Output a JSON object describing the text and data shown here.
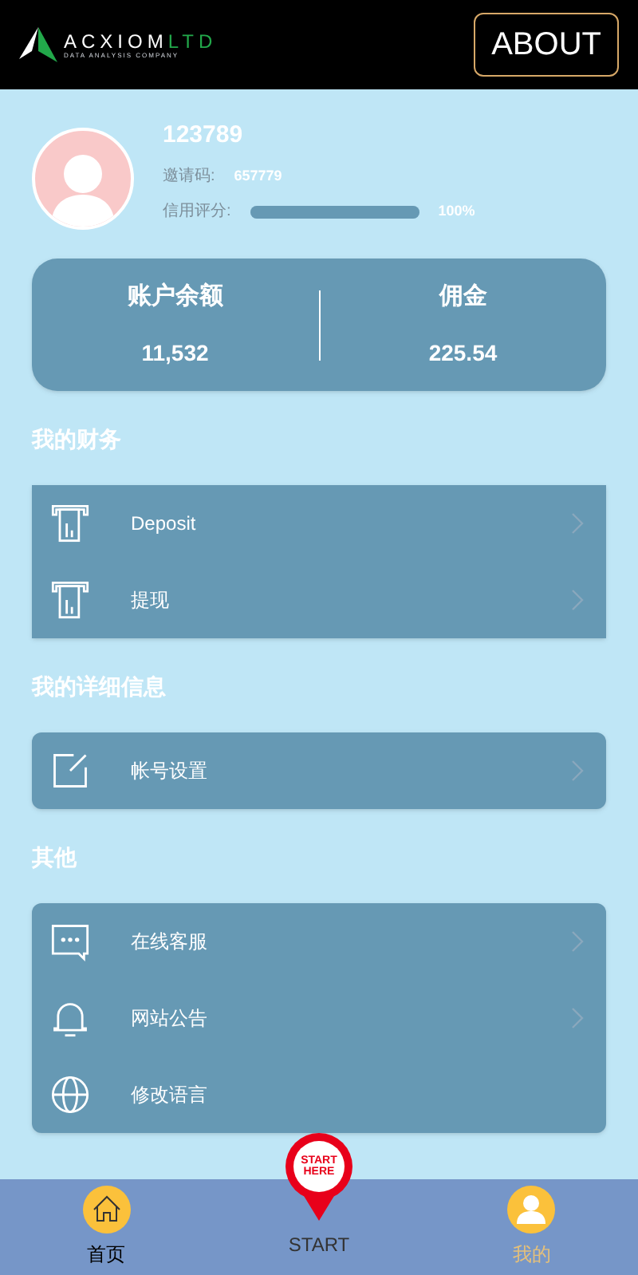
{
  "header": {
    "logo": {
      "name": "ACXIOM",
      "suffix": "LTD",
      "tagline": "DATA ANALYSIS COMPANY"
    },
    "about_button": "ABOUT"
  },
  "profile": {
    "username": "123789",
    "invite_label": "邀请码:",
    "invite_code": "657779",
    "credit_label": "信用评分:",
    "credit": {
      "level": 1.0
    },
    "credit_reading": "100%"
  },
  "balances": [
    {
      "label": "账户余额",
      "value": "11,532"
    },
    {
      "label": "佣金",
      "value": "225.54"
    }
  ],
  "sections": [
    {
      "title": "我的财务",
      "rounded": false,
      "items": [
        {
          "kind": "atm",
          "label": "Deposit",
          "chevron": true
        },
        {
          "kind": "atm",
          "label": "提现",
          "chevron": true
        }
      ]
    },
    {
      "title": "我的详细信息",
      "rounded": true,
      "items": [
        {
          "kind": "edit",
          "label": "帐号设置",
          "chevron": true
        }
      ]
    },
    {
      "title": "其他",
      "rounded": true,
      "items": [
        {
          "kind": "chat",
          "label": "在线客服",
          "chevron": true
        },
        {
          "kind": "bell",
          "label": "网站公告",
          "chevron": true
        },
        {
          "kind": "globe",
          "label": "修改语言",
          "chevron": false
        }
      ]
    }
  ],
  "nav": [
    {
      "kind": "home",
      "label": "首页",
      "selected": false
    },
    {
      "kind": "start",
      "label": "START",
      "pin_text": [
        "START",
        "HERE"
      ],
      "selected": false
    },
    {
      "kind": "user",
      "label": "我的",
      "selected": true
    }
  ]
}
